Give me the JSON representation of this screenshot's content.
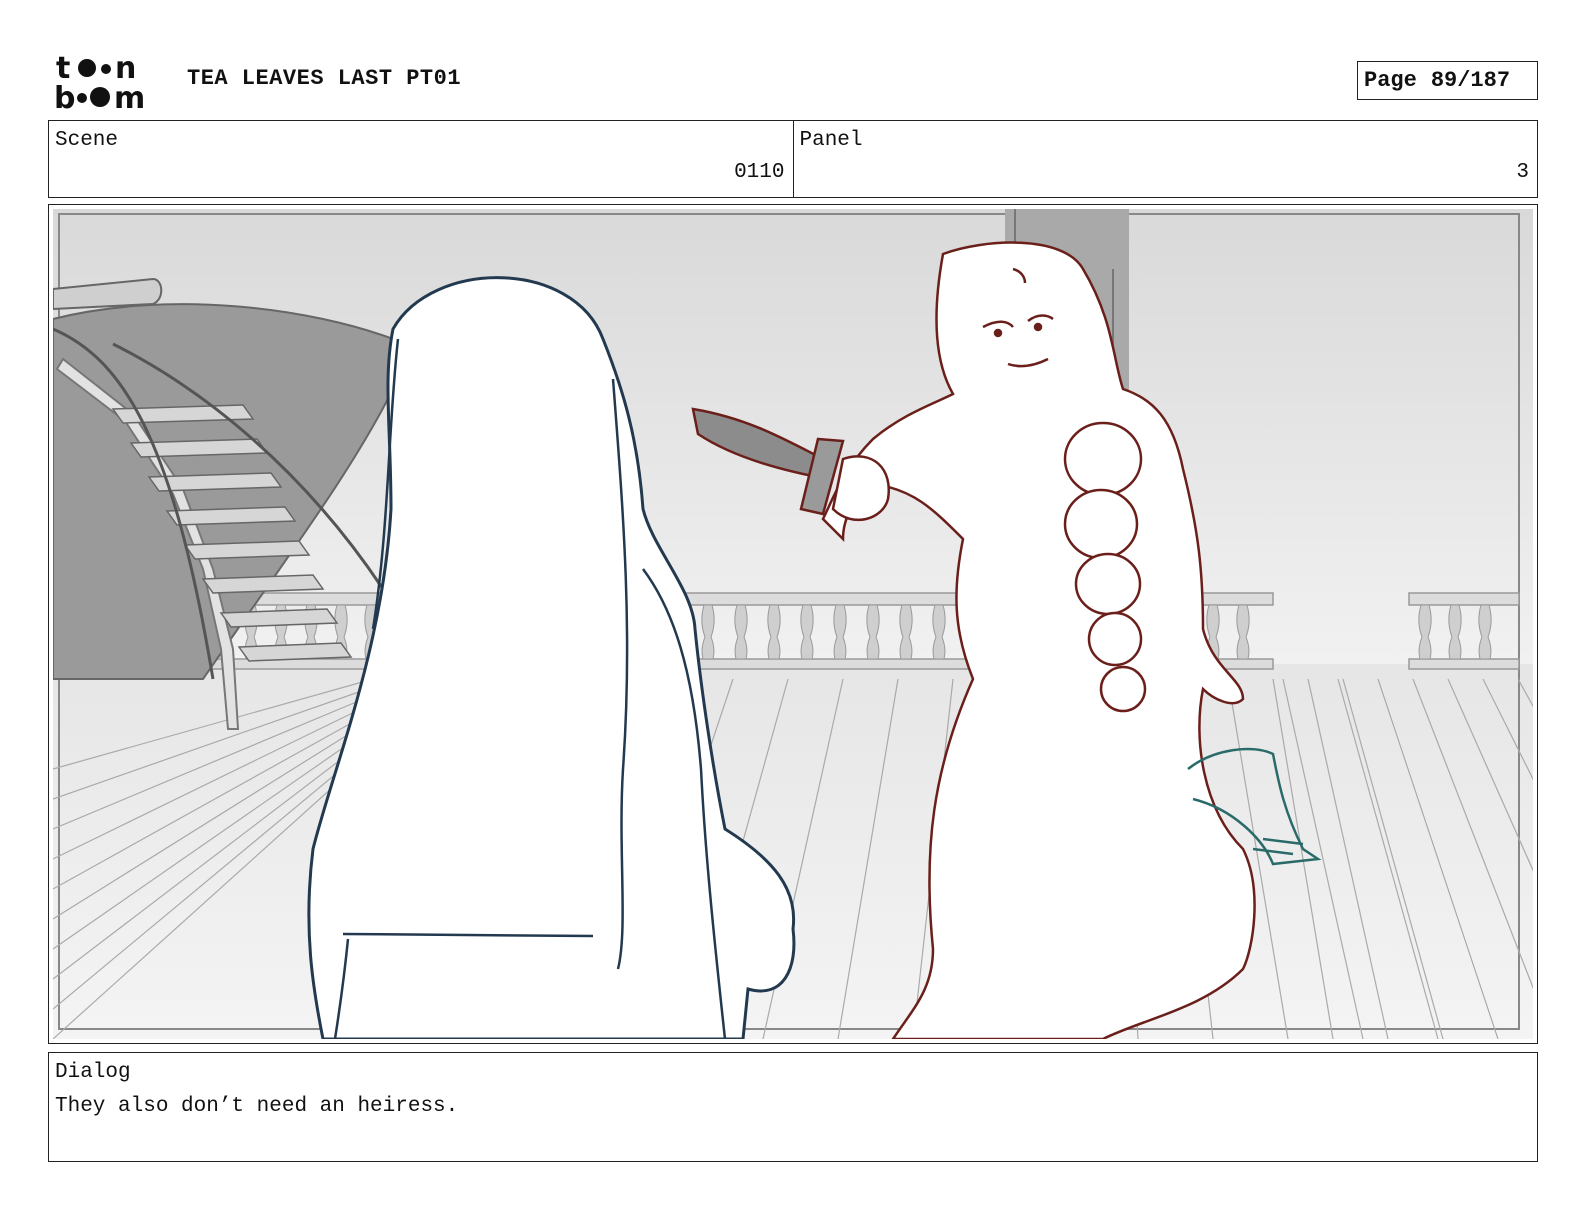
{
  "brand": {
    "logo_text": "toon boom",
    "logo_icon": "toon-boom-logo"
  },
  "header": {
    "title": "TEA LEAVES LAST PT01",
    "page_label": "Page",
    "page_number": "89/187"
  },
  "scene": {
    "label": "Scene",
    "value": "0110"
  },
  "panel": {
    "label": "Panel",
    "value": "3"
  },
  "dialog": {
    "label": "Dialog",
    "text": "They also don’t need an heiress."
  },
  "colors": {
    "figure_left_outline": "#23394f",
    "figure_right_outline": "#6b1f1a",
    "prop_outline": "#2a6b6a"
  }
}
